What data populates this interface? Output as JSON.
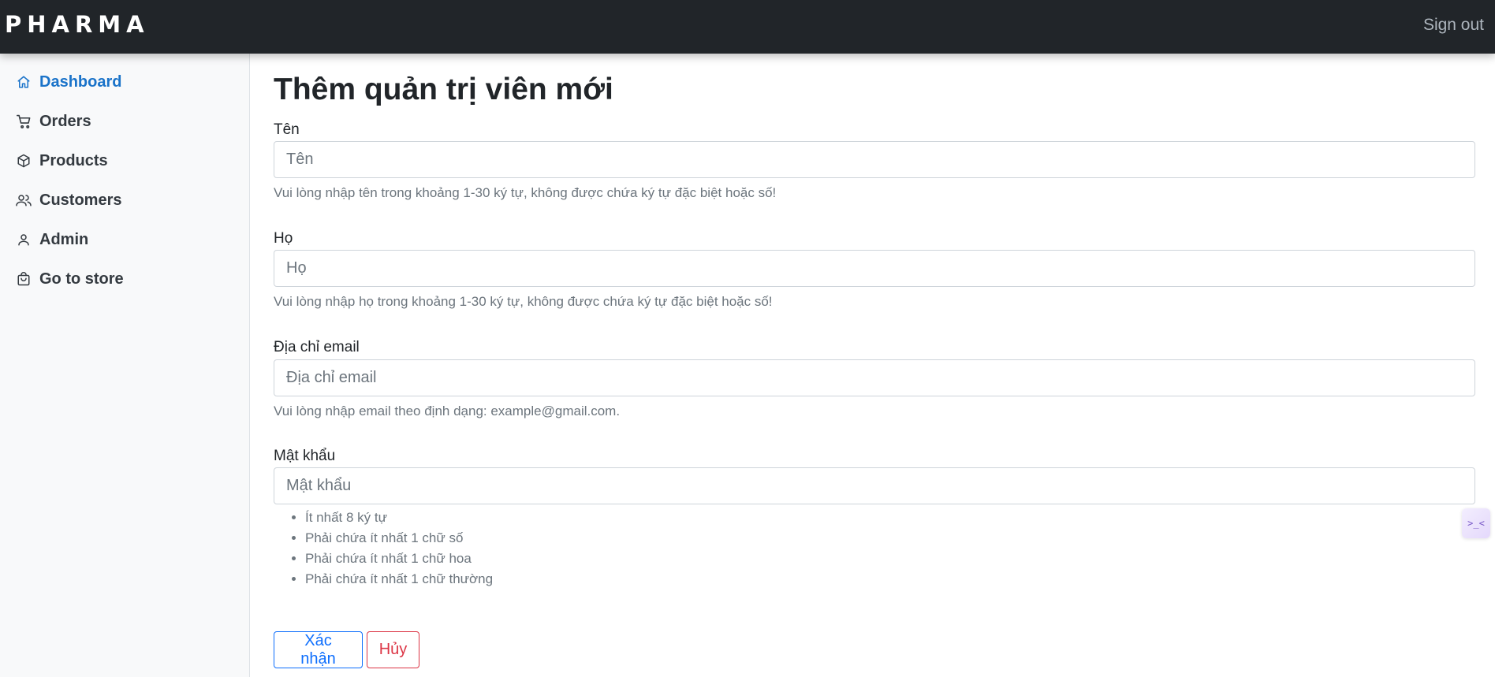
{
  "header": {
    "brand": "PHARMA",
    "signout_label": "Sign out"
  },
  "sidebar": {
    "items": [
      {
        "label": "Dashboard",
        "icon": "home-icon",
        "active": true
      },
      {
        "label": "Orders",
        "icon": "cart-icon",
        "active": false
      },
      {
        "label": "Products",
        "icon": "box-icon",
        "active": false
      },
      {
        "label": "Customers",
        "icon": "users-icon",
        "active": false
      },
      {
        "label": "Admin",
        "icon": "user-icon",
        "active": false
      },
      {
        "label": "Go to store",
        "icon": "bag-icon",
        "active": false
      }
    ]
  },
  "main": {
    "title": "Thêm quản trị viên mới",
    "fields": {
      "first_name": {
        "label": "Tên",
        "placeholder": "Tên",
        "value": "",
        "help": "Vui lòng nhập tên trong khoảng 1-30 ký tự, không được chứa ký tự đặc biệt hoặc số!"
      },
      "last_name": {
        "label": "Họ",
        "placeholder": "Họ",
        "value": "",
        "help": "Vui lòng nhập họ trong khoảng 1-30 ký tự, không được chứa ký tự đặc biệt hoặc số!"
      },
      "email": {
        "label": "Địa chỉ email",
        "placeholder": "Địa chỉ email",
        "value": "",
        "help": "Vui lòng nhập email theo định dạng: example@gmail.com."
      },
      "password": {
        "label": "Mật khẩu",
        "placeholder": "Mật khẩu",
        "value": "",
        "rules": [
          "Ít nhất 8 ký tự",
          "Phải chứa ít nhất 1 chữ số",
          "Phải chứa ít nhất 1 chữ hoa",
          "Phải chứa ít nhất 1 chữ thường"
        ]
      }
    },
    "buttons": {
      "confirm": "Xác nhận",
      "cancel": "Hủy"
    }
  },
  "floating_widget": {
    "icon": "code-collapse-icon",
    "glyph": ">_<"
  },
  "colors": {
    "topbar_bg": "#212529",
    "sidebar_bg": "#f8f9fa",
    "active_nav": "#1a73c9",
    "primary": "#0d6efd",
    "danger": "#dc3545"
  }
}
